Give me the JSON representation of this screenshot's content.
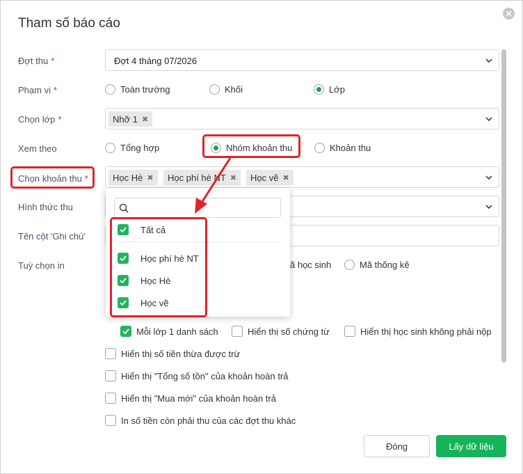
{
  "dialog": {
    "title": "Tham số báo cáo"
  },
  "fields": {
    "dot_thu": {
      "label": "Đợt thu",
      "required": "*",
      "value": "Đợt 4 tháng 07/2026"
    },
    "pham_vi": {
      "label": "Phạm vi",
      "required": "*",
      "options": [
        "Toàn trường",
        "Khối",
        "Lớp"
      ],
      "selected": "Lớp"
    },
    "chon_lop": {
      "label": "Chọn lớp",
      "required": "*",
      "tags": [
        "Nhỡ 1"
      ]
    },
    "xem_theo": {
      "label": "Xem theo",
      "options": [
        "Tổng hợp",
        "Nhóm khoản thu",
        "Khoản thu"
      ],
      "selected": "Nhóm khoản thu"
    },
    "chon_khoan_thu": {
      "label": "Chọn khoản thu",
      "required": "*",
      "tags": [
        "Học Hè",
        "Học phí hè NT",
        "Học vẽ"
      ]
    },
    "hinh_thuc_thu": {
      "label": "Hình thức thu"
    },
    "ten_cot_ghi_chu": {
      "label": "Tên cột 'Ghi chú'"
    },
    "tuy_chon_in": {
      "label": "Tuỳ chọn in",
      "partial_option": "ã học sinh",
      "option2": "Mã thống kê"
    }
  },
  "dropdown": {
    "search_placeholder": "",
    "select_all": "Tất cả",
    "items": [
      "Học phí hè NT",
      "Học Hè",
      "Học vẽ"
    ]
  },
  "checkboxes": {
    "moi_lop": {
      "label": "Mỗi lớp 1 danh sách",
      "checked": true
    },
    "so_chung_tu": {
      "label": "Hiển thị số chứng từ",
      "checked": false
    },
    "hs_khong_nop": {
      "label": "Hiển thị học sinh không phải nộp",
      "checked": false
    },
    "tien_thua": {
      "label": "Hiển thị số tiền thừa được trừ",
      "checked": false
    },
    "tong_so_ton": {
      "label": "Hiển thị \"Tổng số tồn\" của khoản hoàn trả",
      "checked": false
    },
    "mua_moi": {
      "label": "Hiển thị \"Mua mới\" của khoản hoàn trả",
      "checked": false
    },
    "dot_khac": {
      "label": "In số tiền còn phải thu của các đợt thu khác",
      "checked": false
    }
  },
  "buttons": {
    "close": "Đóng",
    "ok": "Lấy dữ liệu"
  },
  "colors": {
    "accent": "#17b35a",
    "annotation": "#e0232b"
  }
}
